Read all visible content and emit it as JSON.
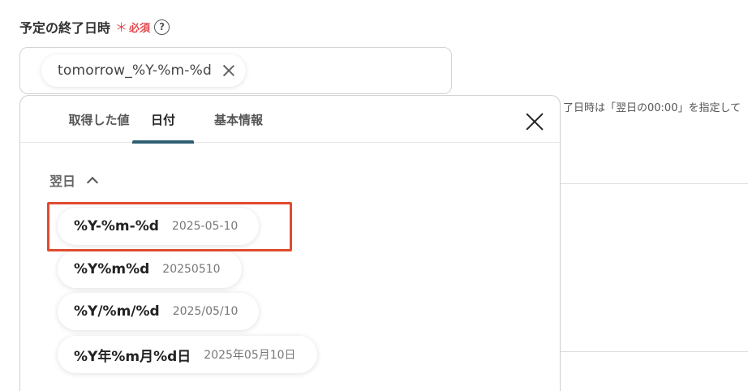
{
  "field": {
    "label": "予定の終了日時",
    "asterisk": "＊",
    "required": "必須",
    "help_glyph": "?"
  },
  "input": {
    "chip_value": "tomorrow_%Y-%m-%d"
  },
  "hint": "了日時は「翌日の00:00」を指定して",
  "dropdown": {
    "tabs": [
      {
        "label": "取得した値",
        "active": false
      },
      {
        "label": "日付",
        "active": true
      },
      {
        "label": "基本情報",
        "active": false
      }
    ],
    "section_label": "翌日",
    "options": [
      {
        "format": "%Y-%m-%d",
        "example": "2025-05-10",
        "highlighted": true
      },
      {
        "format": "%Y%m%d",
        "example": "20250510",
        "highlighted": false
      },
      {
        "format": "%Y/%m/%d",
        "example": "2025/05/10",
        "highlighted": false
      },
      {
        "format": "%Y年%m月%d日",
        "example": "2025年05月10日",
        "highlighted": false
      }
    ]
  },
  "colors": {
    "required_red": "#e5484d",
    "active_tab_underline": "#2d5f73",
    "highlight_border": "#e04b2e"
  },
  "icons": {
    "help": "question-circle-icon",
    "chip_remove": "x-icon",
    "close": "close-icon",
    "collapse": "chevron-up-icon"
  }
}
